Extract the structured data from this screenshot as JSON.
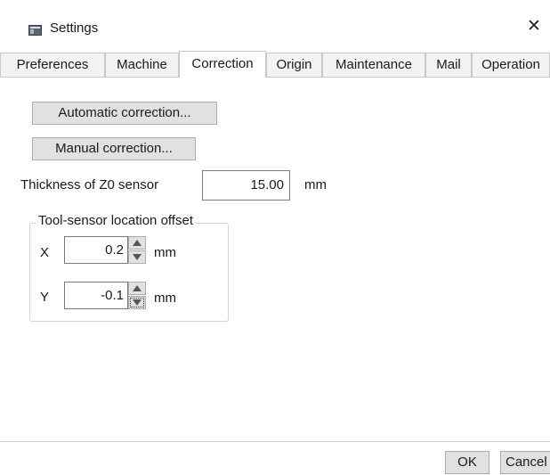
{
  "window": {
    "title": "Settings",
    "close_glyph": "✕"
  },
  "tabs": [
    {
      "label": "Preferences",
      "active": false
    },
    {
      "label": "Machine",
      "active": false
    },
    {
      "label": "Correction",
      "active": true
    },
    {
      "label": "Origin",
      "active": false
    },
    {
      "label": "Maintenance",
      "active": false
    },
    {
      "label": "Mail",
      "active": false
    },
    {
      "label": "Operation",
      "active": false
    }
  ],
  "correction": {
    "auto_button": "Automatic correction...",
    "manual_button": "Manual correction...",
    "thickness_label": "Thickness of Z0 sensor",
    "thickness_value": "15.00",
    "thickness_unit": "mm",
    "offset_group": {
      "title": "Tool-sensor location offset",
      "x_label": "X",
      "x_value": "0.2",
      "x_unit": "mm",
      "y_label": "Y",
      "y_value": "-0.1",
      "y_unit": "mm"
    }
  },
  "footer": {
    "ok_label": "OK",
    "cancel_label": "Cancel"
  }
}
